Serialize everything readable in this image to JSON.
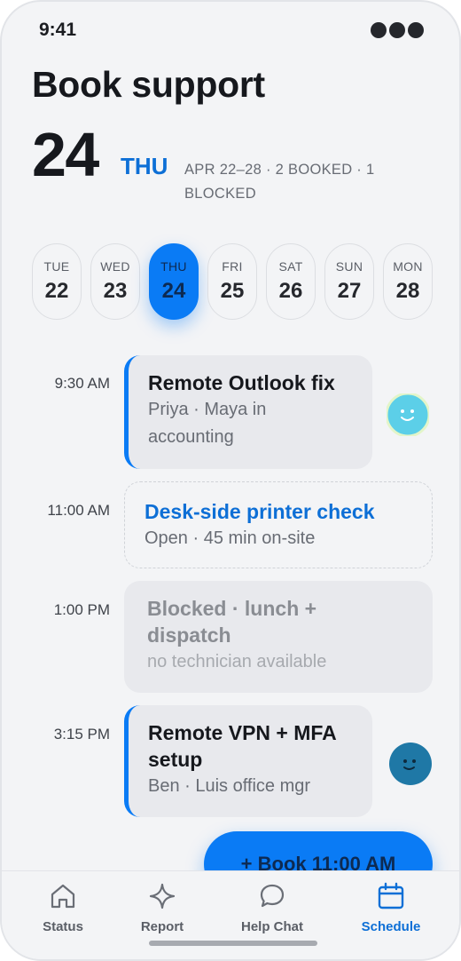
{
  "status_bar": {
    "time": "9:41"
  },
  "header": {
    "title": "Book support",
    "day_number": "24",
    "day_of_week": "THU",
    "week_summary": "APR 22–28 · 2 BOOKED · 1 BLOCKED"
  },
  "days": [
    {
      "dow": "TUE",
      "num": "22",
      "selected": false
    },
    {
      "dow": "WED",
      "num": "23",
      "selected": false
    },
    {
      "dow": "THU",
      "num": "24",
      "selected": true
    },
    {
      "dow": "FRI",
      "num": "25",
      "selected": false
    },
    {
      "dow": "SAT",
      "num": "26",
      "selected": false
    },
    {
      "dow": "SUN",
      "num": "27",
      "selected": false
    },
    {
      "dow": "MON",
      "num": "28",
      "selected": false
    }
  ],
  "slots": [
    {
      "time": "9:30 AM",
      "kind": "booked",
      "title": "Remote Outlook fix",
      "subtitle": "Priya · Maya in accounting",
      "avatar_color": "#5ccfe8"
    },
    {
      "time": "11:00 AM",
      "kind": "open",
      "title": "Desk-side printer check",
      "subtitle": "Open · 45 min on-site"
    },
    {
      "time": "1:00 PM",
      "kind": "blocked",
      "title": "Blocked · lunch + dispatch",
      "subtitle": "no technician available"
    },
    {
      "time": "3:15 PM",
      "kind": "booked",
      "title": "Remote VPN + MFA setup",
      "subtitle": "Ben · Luis office mgr",
      "avatar_color": "#1f78a6"
    }
  ],
  "book_button": {
    "label": "+ Book 11:00 AM"
  },
  "tabs": [
    {
      "label": "Status",
      "icon": "home-icon",
      "active": false
    },
    {
      "label": "Report",
      "icon": "sparkle-icon",
      "active": false
    },
    {
      "label": "Help Chat",
      "icon": "chat-bubble-icon",
      "active": false
    },
    {
      "label": "Schedule",
      "icon": "calendar-icon",
      "active": true
    }
  ],
  "colors": {
    "accent": "#0a7bf5",
    "accent_text": "#0d6fd6",
    "background": "#f3f4f6"
  }
}
